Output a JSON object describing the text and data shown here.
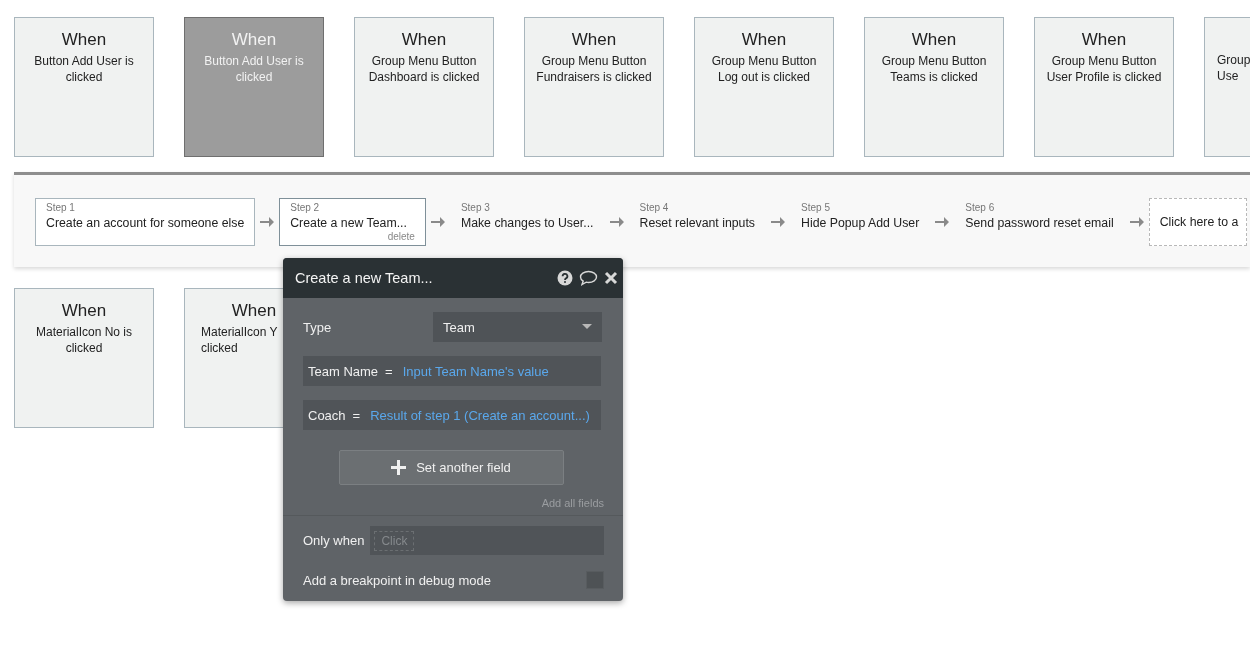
{
  "top_events": [
    {
      "title": "When",
      "lines": [
        "Button Add User is",
        "clicked"
      ],
      "selected": false,
      "kind": "full"
    },
    {
      "title": "When",
      "lines": [
        "Button Add User is",
        "clicked"
      ],
      "selected": true,
      "kind": "full"
    },
    {
      "title": "When",
      "lines": [
        "Group Menu Button",
        "Dashboard is clicked"
      ],
      "selected": false,
      "kind": "full"
    },
    {
      "title": "When",
      "lines": [
        "Group Menu Button",
        "Fundraisers is clicked"
      ],
      "selected": false,
      "kind": "full"
    },
    {
      "title": "When",
      "lines": [
        "Group Menu Button",
        "Log out is clicked"
      ],
      "selected": false,
      "kind": "full"
    },
    {
      "title": "When",
      "lines": [
        "Group Menu Button",
        "Teams is clicked"
      ],
      "selected": false,
      "kind": "full"
    },
    {
      "title": "When",
      "lines": [
        "Group Menu Button",
        "User Profile is clicked"
      ],
      "selected": false,
      "kind": "full"
    },
    {
      "lines": [
        "Group",
        "Use"
      ],
      "selected": false,
      "kind": "cut"
    }
  ],
  "workflow": {
    "steps": [
      {
        "label": "Step 1",
        "title": "Create an account for someone else",
        "selected": false,
        "bordered": true
      },
      {
        "label": "Step 2",
        "title": "Create a new Team...",
        "selected": true,
        "bordered": true,
        "action": "delete"
      },
      {
        "label": "Step 3",
        "title": "Make changes to User...",
        "selected": false,
        "bordered": false
      },
      {
        "label": "Step 4",
        "title": "Reset relevant inputs",
        "selected": false,
        "bordered": false
      },
      {
        "label": "Step 5",
        "title": "Hide Popup Add User",
        "selected": false,
        "bordered": false
      },
      {
        "label": "Step 6",
        "title": "Send password reset email",
        "selected": false,
        "bordered": false
      }
    ],
    "add_step": "Click here to a"
  },
  "bottom_events": [
    {
      "title": "When",
      "lines": [
        "MaterialIcon No is",
        "clicked"
      ],
      "selected": false,
      "kind": "full"
    },
    {
      "title": "When",
      "lines": [
        "MaterialIcon Y",
        "clicked"
      ],
      "selected": false,
      "kind": "covered"
    }
  ],
  "action_panel": {
    "title": "Create a new Team...",
    "type": {
      "label": "Type",
      "value": "Team"
    },
    "fields": [
      {
        "name": "Team Name",
        "operator": "=",
        "value": "Input Team Name's value"
      },
      {
        "name": "Coach",
        "operator": "=",
        "value": "Result of step 1 (Create an account...)"
      }
    ],
    "add_field": "Set another field",
    "add_all": "Add all fields",
    "condition": {
      "label": "Only when",
      "placeholder": "Click"
    },
    "breakpoint": {
      "label": "Add a breakpoint in debug mode",
      "checked": false
    }
  }
}
